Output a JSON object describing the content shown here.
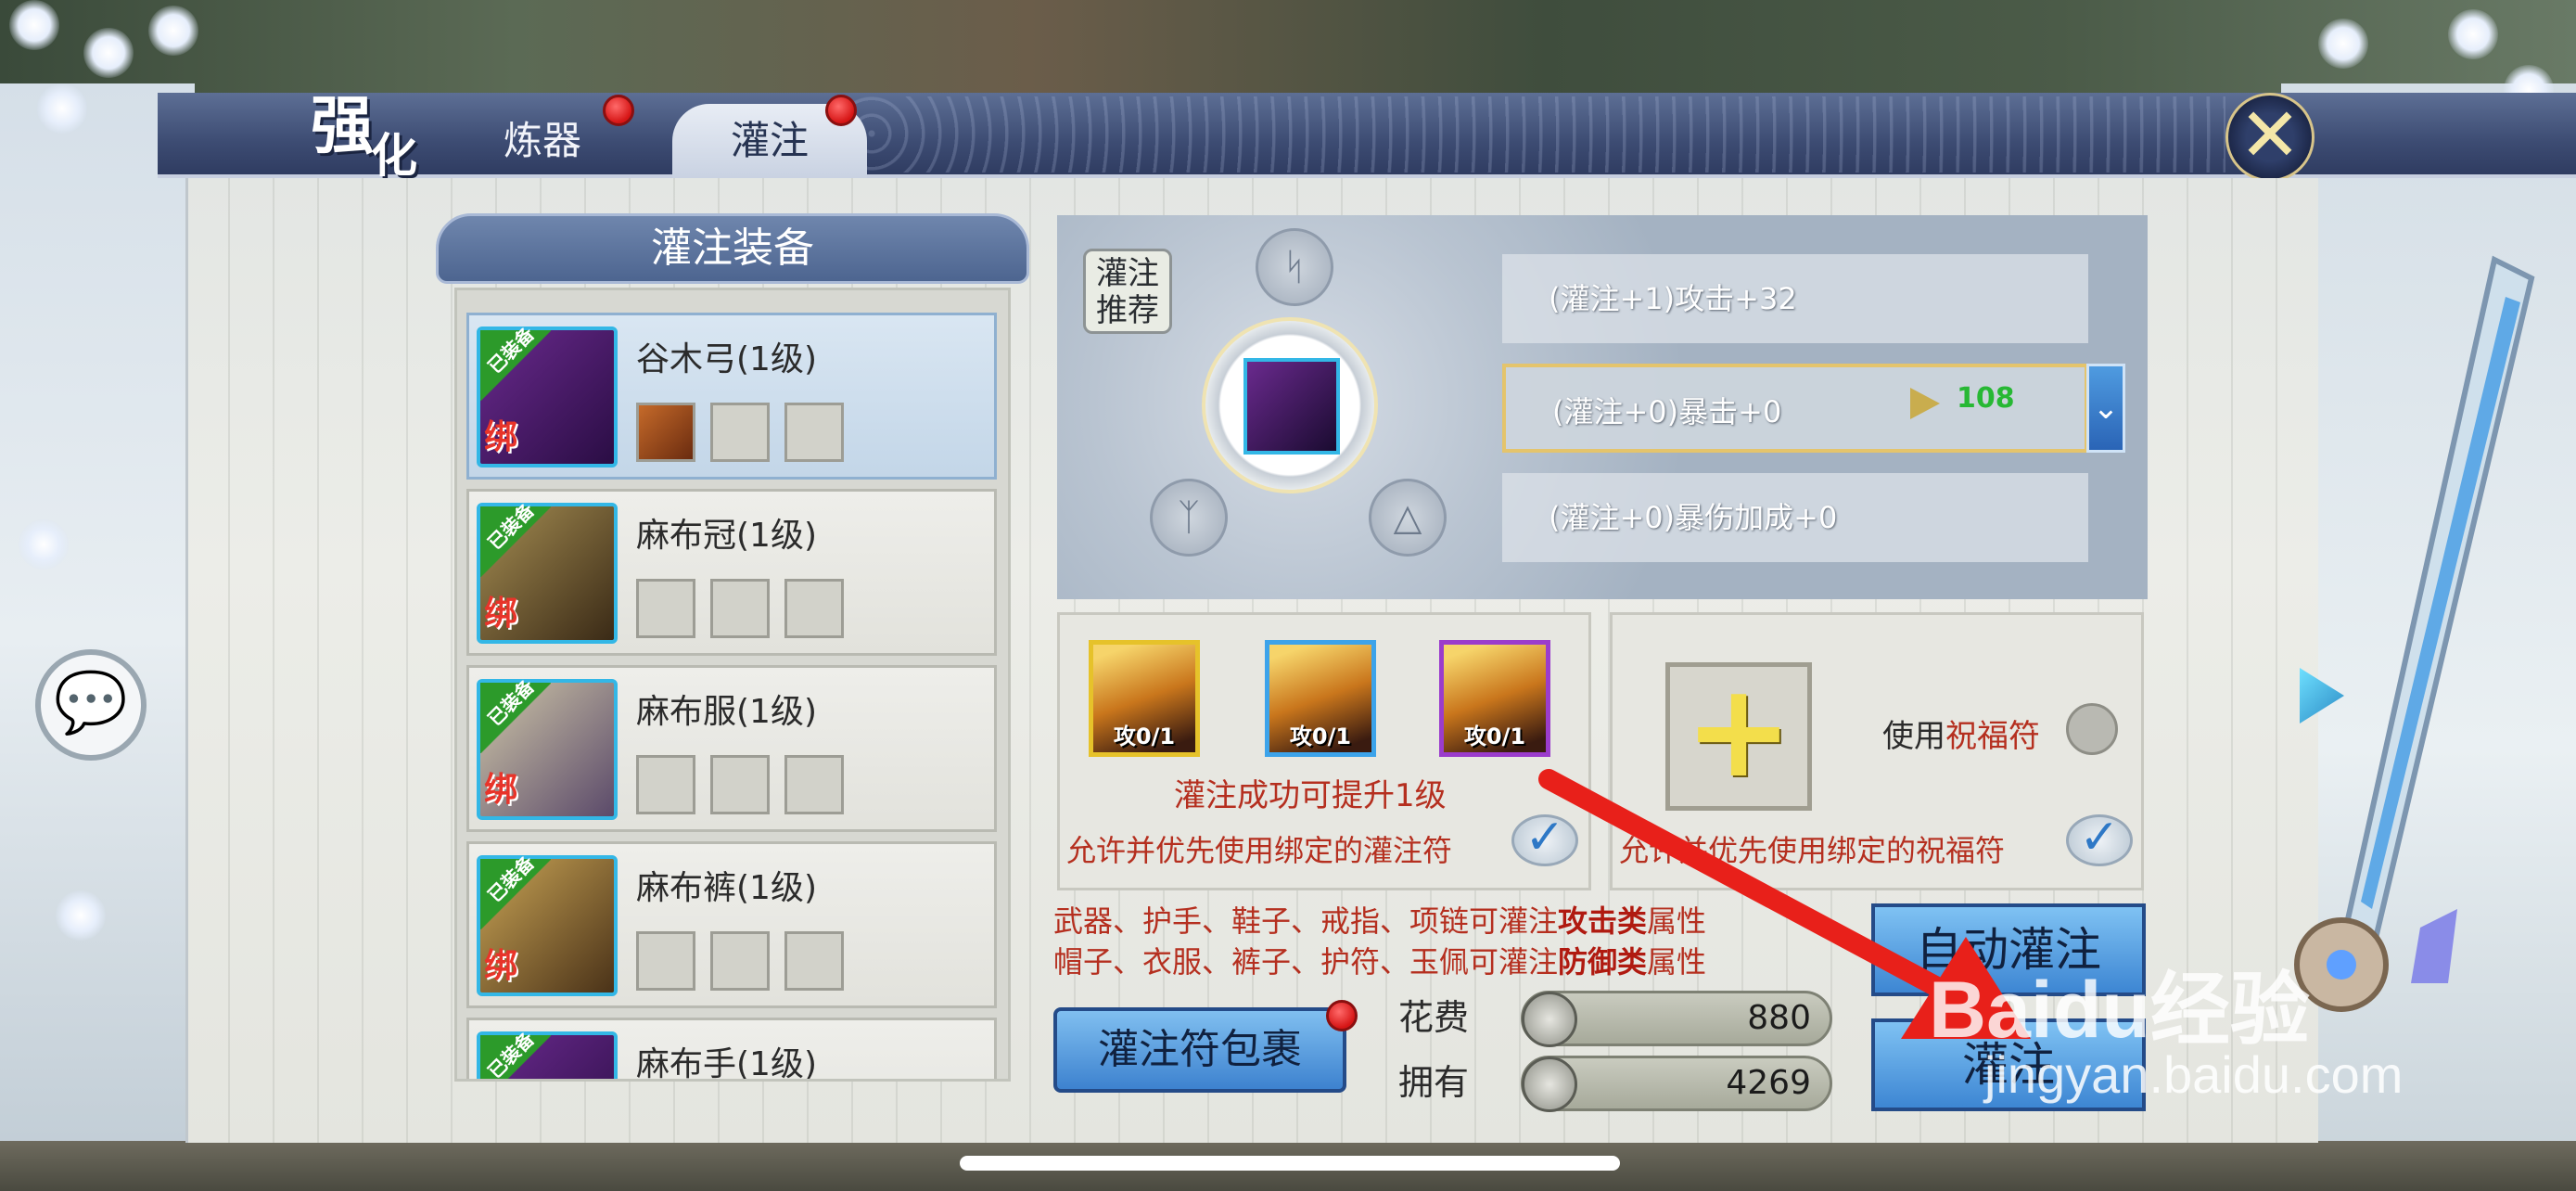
{
  "header": {
    "title_chars": [
      "强",
      "化"
    ],
    "tabs": [
      {
        "label": "炼器",
        "has_notification": true
      },
      {
        "label": "灌注",
        "has_notification": true,
        "selected": true
      }
    ],
    "close_icon": "x-close-icon"
  },
  "equipment_list": {
    "title": "灌注装备",
    "equipped_badge": "已装备",
    "bound_tag": "绑",
    "items": [
      {
        "name": "谷木弓(1级)",
        "slots_filled": 1,
        "selected": true
      },
      {
        "name": "麻布冠(1级)",
        "slots_filled": 0
      },
      {
        "name": "麻布服(1级)",
        "slots_filled": 0
      },
      {
        "name": "麻布裤(1级)",
        "slots_filled": 0
      },
      {
        "name": "麻布手(1级)",
        "slots_filled": 0
      }
    ]
  },
  "recommend": {
    "label_line1": "灌注",
    "label_line2": "推荐"
  },
  "stats": [
    {
      "text": "(灌注+1)攻击+32"
    },
    {
      "text": "(灌注+0)暴击+0",
      "highlighted": true,
      "next_value": "108"
    },
    {
      "text": "(灌注+0)暴伤加成+0"
    }
  ],
  "materials": {
    "items": [
      {
        "count": "攻0/1",
        "rarity": "gold"
      },
      {
        "count": "攻0/1",
        "rarity": "blue"
      },
      {
        "count": "攻0/1",
        "rarity": "purple"
      }
    ],
    "success_text": "灌注成功可提升1级",
    "allow_text": "允许并优先使用绑定的灌注符"
  },
  "blessing": {
    "label_prefix": "使用",
    "label_highlight": "祝福符",
    "allow_text": "允许并优先使用绑定的祝福符"
  },
  "info": {
    "line1_a": "武器、护手、鞋子、戒指、项链可灌注",
    "line1_b": "攻击类",
    "line1_c": "属性",
    "line2_a": "帽子、衣服、裤子、护符、玉佩可灌注",
    "line2_b": "防御类",
    "line2_c": "属性"
  },
  "footer": {
    "pack_button": "灌注符包裹",
    "cost_label": "花费",
    "cost_value": "880",
    "own_label": "拥有",
    "own_value": "4269",
    "auto_button": "自动灌注",
    "infuse_button": "灌注"
  },
  "watermark": {
    "logo": "Baidu经验",
    "url": "jingyan.baidu.com"
  },
  "colors": {
    "header_bg": "#3d4c73",
    "accent_red": "#b52f1f",
    "button_blue": "#3d86d3",
    "highlight_gold": "#e4c46c",
    "green_value": "#27b834",
    "annotation_arrow": "#e8201a"
  }
}
